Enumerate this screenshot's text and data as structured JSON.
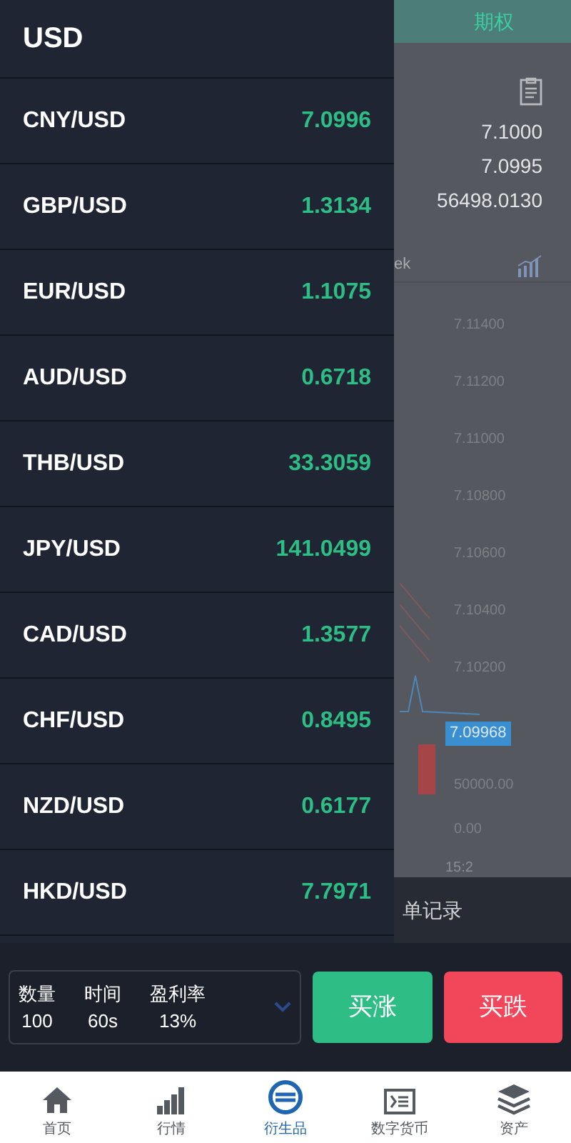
{
  "drawer": {
    "title": "USD",
    "pairs": [
      {
        "name": "CNY/USD",
        "price": "7.0996"
      },
      {
        "name": "GBP/USD",
        "price": "1.3134"
      },
      {
        "name": "EUR/USD",
        "price": "1.1075"
      },
      {
        "name": "AUD/USD",
        "price": "0.6718"
      },
      {
        "name": "THB/USD",
        "price": "33.3059"
      },
      {
        "name": "JPY/USD",
        "price": "141.0499"
      },
      {
        "name": "CAD/USD",
        "price": "1.3577"
      },
      {
        "name": "CHF/USD",
        "price": "0.8495"
      },
      {
        "name": "NZD/USD",
        "price": "0.6177"
      },
      {
        "name": "HKD/USD",
        "price": "7.7971"
      }
    ]
  },
  "background_page": {
    "tab": "期权",
    "stats": [
      "7.1000",
      "7.0995",
      "56498.0130"
    ],
    "period_label": "ek",
    "chart_axis": [
      "7.11400",
      "7.11200",
      "7.11000",
      "7.10800",
      "7.10600",
      "7.10400",
      "7.10200"
    ],
    "current_price": "7.09968",
    "volume_axis": [
      "50000.00",
      "0.00"
    ],
    "time_label": "15:2",
    "orders_link": "单记录"
  },
  "trade_bar": {
    "fields": [
      {
        "label": "数量",
        "value": "100"
      },
      {
        "label": "时间",
        "value": "60s"
      },
      {
        "label": "盈利率",
        "value": "13%"
      }
    ],
    "buy_up": "买涨",
    "buy_down": "买跌"
  },
  "nav": [
    {
      "label": "首页",
      "kind": "home",
      "selected": false
    },
    {
      "label": "行情",
      "kind": "market",
      "selected": false
    },
    {
      "label": "衍生品",
      "kind": "derivatives",
      "selected": true
    },
    {
      "label": "数字货币",
      "kind": "digital",
      "selected": false
    },
    {
      "label": "资产",
      "kind": "assets",
      "selected": false
    }
  ]
}
